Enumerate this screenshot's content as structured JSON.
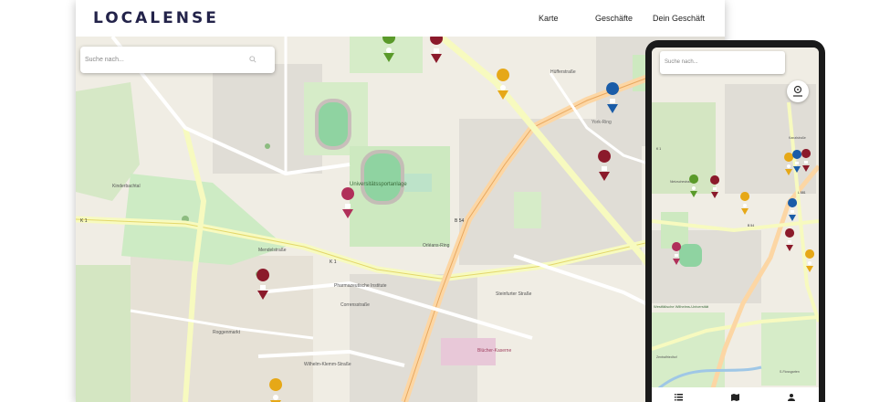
{
  "app": {
    "logo": "LOCALENSE"
  },
  "nav": {
    "items": [
      "Karte",
      "Geschäfte",
      "Dein Geschäft"
    ]
  },
  "search": {
    "placeholder": "Suche nach..."
  },
  "mobile": {
    "search_placeholder": "Suche nach..."
  },
  "map_labels": {
    "stadium": "Universitätssportanlage",
    "pharm": "Pharmazeutische Institute",
    "kaserne": "Blücher-Kaserne",
    "wwu": "Westfälische Wilhelms-Universität",
    "york": "York-Ring",
    "k1": "K 1",
    "b54": "B 54",
    "k1b": "K 1",
    "meckl": "Mendelstraße",
    "rcstr": "Roggenmarkt",
    "orleans": "Orléans-Ring",
    "kinder": "Kinderbachtal",
    "huefferstr": "Hüfferstraße",
    "wilhelmklemm": "Wilhelm-Klemm-Straße",
    "corrensstr": "Corrensstraße",
    "steinfurter": "Steinfurter Straße",
    "m_nietzsche": "Nietzschestraße",
    "m_k1": "K 1",
    "m_b54": "B 54",
    "m_l581": "L 581",
    "m_kanal": "Kanalstraße",
    "m_friedhof": "Zentralfriedhof",
    "m_ss": "S-Flossgarten"
  },
  "colors": {
    "accent": "#23234a",
    "pin_red": "#8b1a2b",
    "pin_green": "#5a9a2a",
    "pin_yellow": "#e6a817",
    "pin_blue": "#1a5ca8",
    "pin_pink": "#b0305a"
  }
}
